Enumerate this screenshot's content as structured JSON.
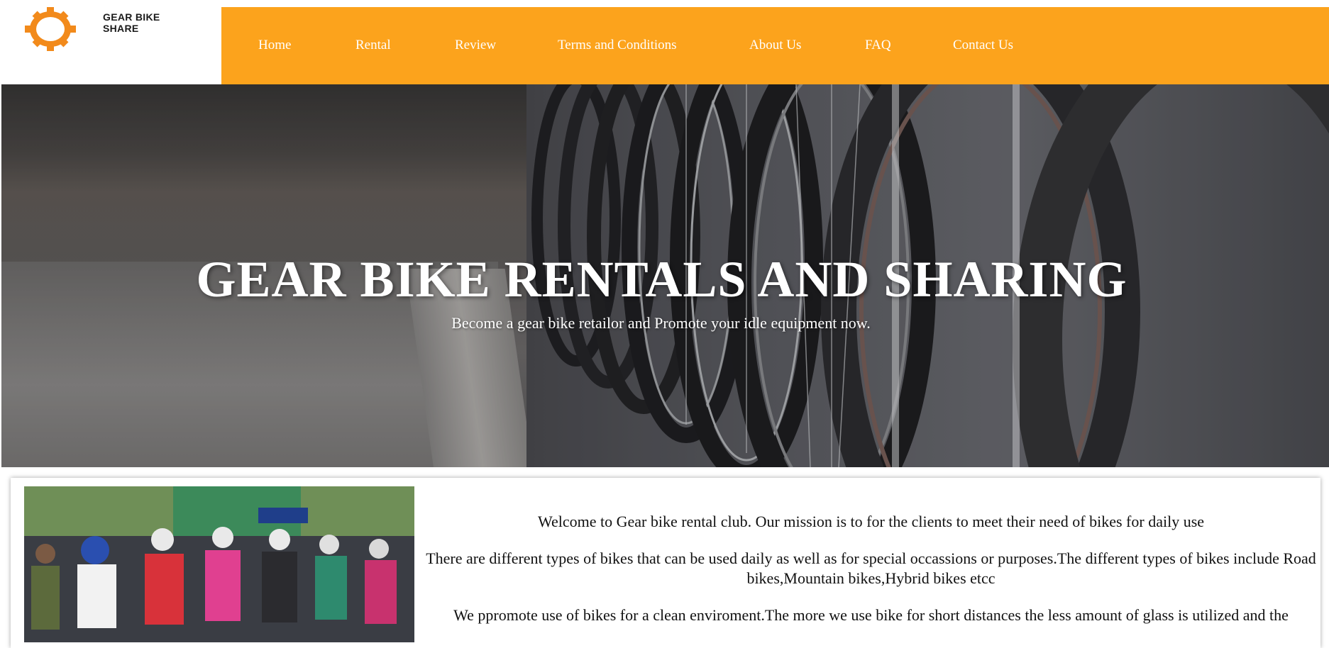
{
  "brand": {
    "logo_icon": "gear-icon",
    "name": "GEAR BIKE SHARE",
    "accent_color": "#fca31c"
  },
  "nav": {
    "items": [
      {
        "label": "Home"
      },
      {
        "label": "Rental"
      },
      {
        "label": "Review"
      },
      {
        "label": "Terms and Conditions"
      },
      {
        "label": "About Us"
      },
      {
        "label": "FAQ"
      },
      {
        "label": "Contact Us"
      }
    ]
  },
  "hero": {
    "title": "GEAR BIKE RENTALS AND SHARING",
    "subtitle": "Become a gear bike retailor and Promote your idle equipment now."
  },
  "intro": {
    "paragraphs": [
      "Welcome to Gear bike rental club. Our mission is to for the clients to meet their need of bikes for daily use",
      "There are different types of bikes that can be used daily as well as for special occassions or purposes.The different types of bikes include Road bikes,Mountain bikes,Hybrid bikes etcc",
      "We ppromote use of bikes for a clean enviroment.The more we use bike for short distances the less amount of glass is utilized and the"
    ]
  }
}
